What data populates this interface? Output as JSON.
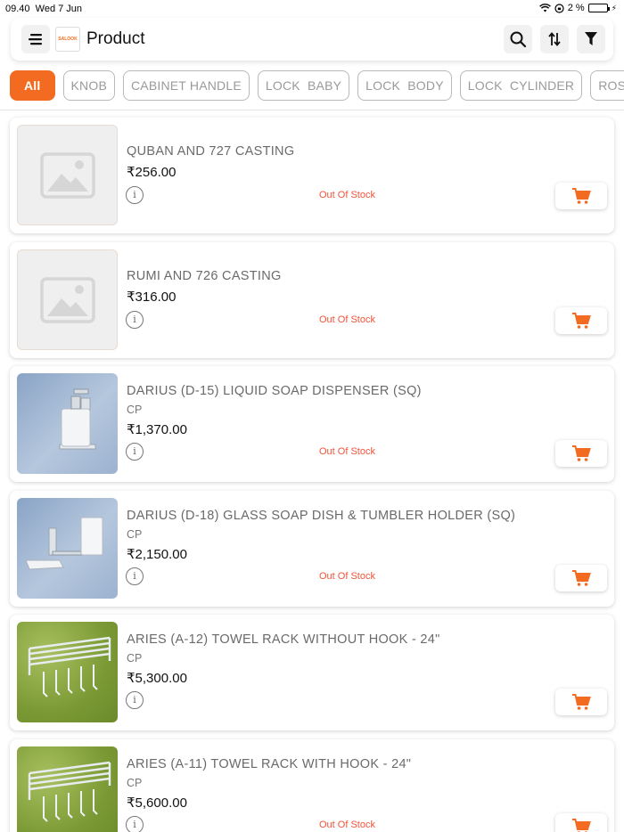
{
  "status_bar": {
    "time": "09.40",
    "date": "Wed 7 Jun",
    "battery": "2 %"
  },
  "header": {
    "title": "Product",
    "logo_text": "SALOOK",
    "icons": [
      "menu-icon",
      "search-icon",
      "sort-icon",
      "filter-icon"
    ]
  },
  "categories": [
    "All",
    "KNOB",
    "CABINET HANDLE",
    "LOCK  BABY",
    "LOCK  BODY",
    "LOCK  CYLINDER",
    "ROSE"
  ],
  "active_category": "All",
  "colors": {
    "accent": "#f26b21",
    "out_of_stock": "#f0533a"
  },
  "products": [
    {
      "name": "QUBAN AND 727 CASTING",
      "variant": "",
      "price": "₹256.00",
      "stock": "Out Of Stock",
      "image": "placeholder"
    },
    {
      "name": "RUMI AND 726 CASTING",
      "variant": "",
      "price": "₹316.00",
      "stock": "Out Of Stock",
      "image": "placeholder"
    },
    {
      "name": "DARIUS (D-15) LIQUID SOAP DISPENSER (SQ)",
      "variant": "CP",
      "price": "₹1,370.00",
      "stock": "Out Of Stock",
      "image": "soap-dispenser"
    },
    {
      "name": "DARIUS (D-18) GLASS SOAP DISH & TUMBLER HOLDER (SQ)",
      "variant": "CP",
      "price": "₹2,150.00",
      "stock": "Out Of Stock",
      "image": "soap-dish"
    },
    {
      "name": "ARIES (A-12) TOWEL RACK WITHOUT HOOK - 24\"",
      "variant": "CP",
      "price": "₹5,300.00",
      "stock": "",
      "image": "towel-rack"
    },
    {
      "name": "ARIES (A-11) TOWEL RACK WITH HOOK - 24\"",
      "variant": "CP",
      "price": "₹5,600.00",
      "stock": "Out Of Stock",
      "image": "towel-rack"
    }
  ]
}
